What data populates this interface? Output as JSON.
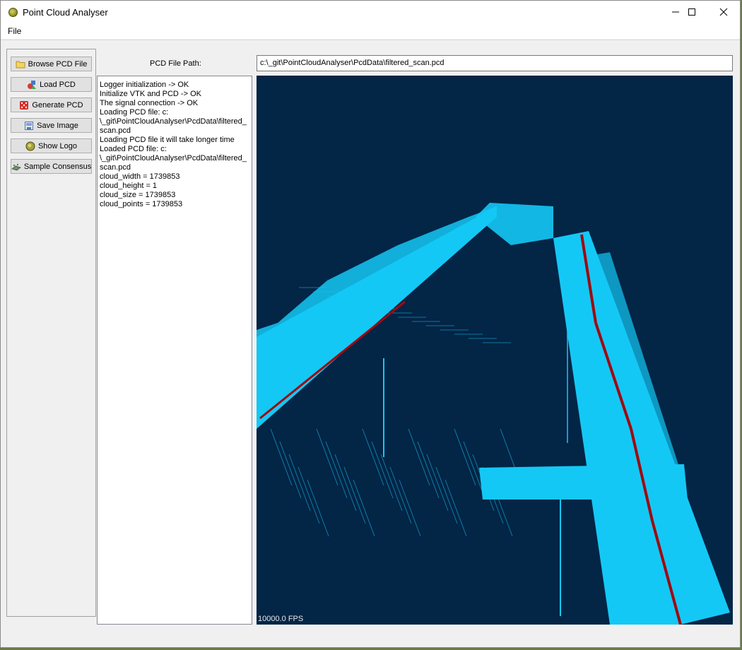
{
  "window": {
    "title": "Point Cloud Analyser",
    "controls": [
      "minimize-icon",
      "maximize-icon",
      "close-icon"
    ]
  },
  "menu": {
    "file": "File"
  },
  "toolbar": {
    "browse": "Browse PCD File",
    "load": "Load PCD",
    "generate": "Generate PCD",
    "save_image": "Save Image",
    "show_logo": "Show Logo",
    "sample_consensus": "Sample Consensus"
  },
  "path": {
    "label": "PCD File Path:",
    "value": "c:\\_git\\PointCloudAnalyser\\PcdData\\filtered_scan.pcd"
  },
  "log": [
    "Logger initialization -> OK",
    "Initialize VTK and PCD -> OK",
    "The signal connection -> OK",
    "Loading PCD file: c:\n\\_git\\PointCloudAnalyser\\PcdData\\filtered_\nscan.pcd",
    "Loading PCD file it will take longer time",
    "Loaded PCD file: c:\n\\_git\\PointCloudAnalyser\\PcdData\\filtered_\nscan.pcd",
    "cloud_width = 1739853",
    "cloud_height = 1",
    "cloud_size = 1739853",
    "cloud_points = 1739853"
  ],
  "viewer": {
    "fps": "10000.0 FPS",
    "background": "#032546",
    "point_color": "#14c8f5",
    "highlight_color": "#a00a10"
  }
}
